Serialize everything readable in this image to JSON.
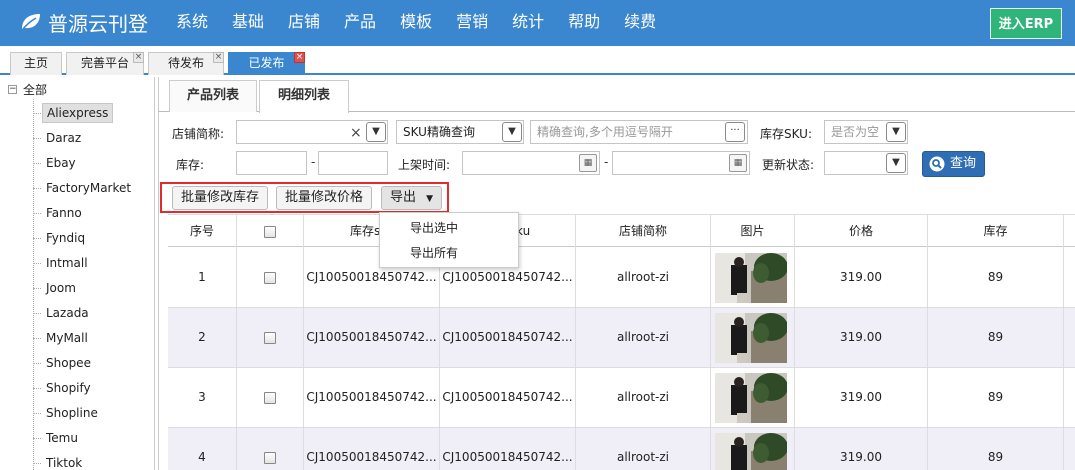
{
  "header": {
    "brand": "普源云刊登",
    "nav": [
      "系统",
      "基础",
      "店铺",
      "产品",
      "模板",
      "营销",
      "统计",
      "帮助",
      "续费"
    ],
    "erp_button": "进入ERP"
  },
  "tabs": [
    {
      "label": "主页",
      "closable": false,
      "active": false
    },
    {
      "label": "完善平台",
      "closable": true,
      "active": false
    },
    {
      "label": "待发布",
      "closable": true,
      "active": false
    },
    {
      "label": "已发布",
      "closable": true,
      "active": true
    }
  ],
  "tree": {
    "root": "全部",
    "toggle": "−",
    "items": [
      "Aliexpress",
      "Daraz",
      "Ebay",
      "FactoryMarket",
      "Fanno",
      "Fyndiq",
      "Intmall",
      "Joom",
      "Lazada",
      "MyMall",
      "Shopee",
      "Shopify",
      "Shopline",
      "Temu",
      "Tiktok"
    ],
    "selected": "Aliexpress"
  },
  "subtabs": [
    {
      "label": "产品列表",
      "active": false
    },
    {
      "label": "明细列表",
      "active": true
    }
  ],
  "filters": {
    "store_label": "店铺简称:",
    "store_value": "",
    "clear_glyph": "×",
    "sku_mode": "SKU精确查询",
    "sku_placeholder": "精确查询,多个用逗号隔开",
    "more_glyph": "···",
    "stock_sku_label": "库存SKU:",
    "stock_sku_placeholder": "是否为空",
    "stock_label": "库存:",
    "stock_from": "",
    "stock_to": "",
    "range_sep": "-",
    "listed_time_label": "上架时间:",
    "listed_from": "",
    "listed_to": "",
    "update_status_label": "更新状态:",
    "update_status_value": "",
    "query_button": "查询"
  },
  "actions": {
    "batch_stock": "批量修改库存",
    "batch_price": "批量修改价格",
    "export": "导出"
  },
  "export_menu": [
    "导出选中",
    "导出所有"
  ],
  "table": {
    "columns": [
      "序号",
      "",
      "库存sku",
      "sku",
      "店铺简称",
      "图片",
      "价格",
      "库存"
    ],
    "visible_header_fragments": {
      "col2": "库存s",
      "col3": "ku"
    },
    "rows": [
      {
        "index": "1",
        "stock_sku": "CJ10050018450742...",
        "sku": "CJ10050018450742...",
        "store": "allroot-zi",
        "price": "319.00",
        "stock": "89"
      },
      {
        "index": "2",
        "stock_sku": "CJ10050018450742...",
        "sku": "CJ10050018450742...",
        "store": "allroot-zi",
        "price": "319.00",
        "stock": "89"
      },
      {
        "index": "3",
        "stock_sku": "CJ10050018450742...",
        "sku": "CJ10050018450742...",
        "store": "allroot-zi",
        "price": "319.00",
        "stock": "89"
      },
      {
        "index": "4",
        "stock_sku": "CJ10050018450742...",
        "sku": "CJ10050018450742...",
        "store": "allroot-zi",
        "price": "319.00",
        "stock": "89"
      }
    ]
  },
  "colors": {
    "header_bg": "#3a86cf",
    "erp_bg": "#2fb57a",
    "query_bg": "#2f6db5",
    "highlight": "#e22b2b",
    "alt_row": "#f0eef6"
  }
}
